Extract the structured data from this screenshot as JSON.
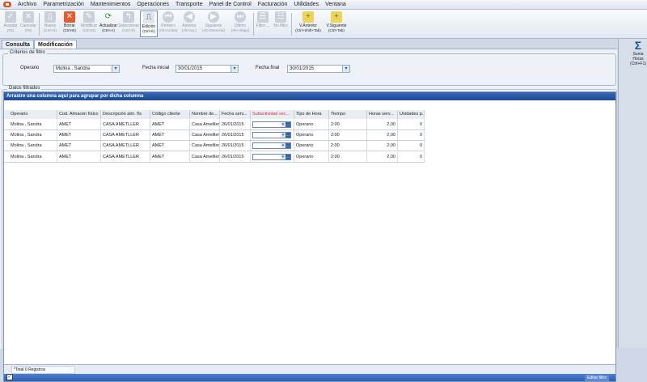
{
  "menu": [
    "Archivo",
    "Parametrización",
    "Mantenimientos",
    "Operaciones",
    "Transporte",
    "Panel de Control",
    "Facturación",
    "Utilidades",
    "Ventana"
  ],
  "toolbar": [
    {
      "label": "Aceptar",
      "shortcut": "(F5)",
      "icon": "check-icon",
      "state": "disabled"
    },
    {
      "label": "Cancelar",
      "shortcut": "(F8)",
      "icon": "cancel-icon",
      "state": "disabled"
    },
    {
      "label": "Nuevo",
      "shortcut": "(Ctrl+N)",
      "icon": "new-icon",
      "state": "disabled"
    },
    {
      "label": "Borrar",
      "shortcut": "(Ctrl+B)",
      "icon": "delete-icon",
      "state": "enabled"
    },
    {
      "label": "Modificar",
      "shortcut": "(Ctrl+D)",
      "icon": "edit-icon",
      "state": "disabled"
    },
    {
      "label": "Actualizar",
      "shortcut": "(Ctrl+A)",
      "icon": "refresh-icon",
      "state": "enabled"
    },
    {
      "label": "Seleccionar",
      "shortcut": "(Ctrl+S)",
      "icon": "select-icon",
      "state": "disabled"
    },
    {
      "label": "Edición",
      "shortcut": "(Ctrl+E)",
      "icon": "edition-icon",
      "state": "active"
    },
    {
      "label": "Primero",
      "shortcut": "(Alt+Arriba)",
      "icon": "first-icon",
      "state": "disabled"
    },
    {
      "label": "Anterior",
      "shortcut": "(Alt+Izq.)",
      "icon": "previous-icon",
      "state": "disabled"
    },
    {
      "label": "Siguiente",
      "shortcut": "(Alt+Derecha)",
      "icon": "next-icon",
      "state": "disabled"
    },
    {
      "label": "Último",
      "shortcut": "(Alt+Abajo)",
      "icon": "last-icon",
      "state": "disabled"
    },
    {
      "label": "Filtro ...",
      "shortcut": "",
      "icon": "filter-icon",
      "state": "disabled"
    },
    {
      "label": "No filtro",
      "shortcut": "",
      "icon": "no-filter-icon",
      "state": "disabled"
    },
    {
      "label": "V.Anterior",
      "shortcut": "(Ctrl+Shift+Tab)",
      "icon": "prev-window-icon",
      "state": "enabled"
    },
    {
      "label": "V.Siguiente",
      "shortcut": "(Ctrl+Tab)",
      "icon": "next-window-icon",
      "state": "enabled"
    }
  ],
  "tabs": [
    "Consulta",
    "Modificación"
  ],
  "filters": {
    "group_title": "Criterios de filtro",
    "operario_label": "Operario",
    "operario_value": "Molina , Sandra",
    "fecha_inicial_label": "Fecha inicial",
    "fecha_inicial_value": "30/01/2015",
    "fecha_final_label": "Fecha final",
    "fecha_final_value": "30/01/2015"
  },
  "data_group_title": "Datos filtrados",
  "grid": {
    "group_by_hint": "Arrastre una columna aquí para agrupar por dicha columna",
    "columns": [
      "Operario",
      "Cod. Almacén físico",
      "Descripción alm. fís",
      "Código cliente",
      "Nombre de...",
      "Fecha serv...",
      "Subactividad sec...",
      "Tipo de Hora",
      "Tiempo",
      "Horas serv...",
      "Unidades p..."
    ],
    "rows": [
      [
        "Molina , Sandra",
        "AMET",
        "CASA AMETLLER",
        "AMET",
        "Casa Ametller",
        "26/01/2015",
        "",
        "Operario",
        "2:00",
        "2,00",
        "0"
      ],
      [
        "Molina , Sandra",
        "AMET",
        "CASA AMETLLER",
        "AMET",
        "Casa Ametller",
        "26/01/2015",
        "",
        "Operario",
        "2:00",
        "2,00",
        "0"
      ],
      [
        "Molina , Sandra",
        "AMET",
        "CASA AMETLLER",
        "AMET",
        "Casa Ametller",
        "26/01/2015",
        "",
        "Operario",
        "2:00",
        "2,00",
        "0"
      ],
      [
        "Molina , Sandra",
        "AMET",
        "CASA AMETLLER",
        "AMET",
        "Casa Ametller",
        "26/01/2015",
        "",
        "Operario",
        "2:00",
        "2,00",
        "0"
      ]
    ],
    "total_text": "*Total 0 Registros",
    "edit_filter_label": "Editar filtro"
  },
  "side": {
    "label_1": "Suma",
    "label_2": "Horas",
    "label_3": "(Ctrl+F1)",
    "icon": "sigma-icon"
  },
  "colors": {
    "header_blue": "#1d4a98",
    "subactividad_header": "#d9302a",
    "accent_red": "#e0522a"
  }
}
